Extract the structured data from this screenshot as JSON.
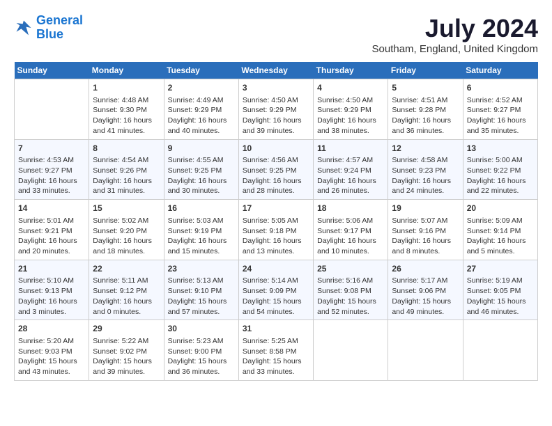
{
  "logo": {
    "line1": "General",
    "line2": "Blue"
  },
  "title": "July 2024",
  "subtitle": "Southam, England, United Kingdom",
  "columns": [
    "Sunday",
    "Monday",
    "Tuesday",
    "Wednesday",
    "Thursday",
    "Friday",
    "Saturday"
  ],
  "weeks": [
    [
      {
        "day": "",
        "info": ""
      },
      {
        "day": "1",
        "info": "Sunrise: 4:48 AM\nSunset: 9:30 PM\nDaylight: 16 hours\nand 41 minutes."
      },
      {
        "day": "2",
        "info": "Sunrise: 4:49 AM\nSunset: 9:29 PM\nDaylight: 16 hours\nand 40 minutes."
      },
      {
        "day": "3",
        "info": "Sunrise: 4:50 AM\nSunset: 9:29 PM\nDaylight: 16 hours\nand 39 minutes."
      },
      {
        "day": "4",
        "info": "Sunrise: 4:50 AM\nSunset: 9:29 PM\nDaylight: 16 hours\nand 38 minutes."
      },
      {
        "day": "5",
        "info": "Sunrise: 4:51 AM\nSunset: 9:28 PM\nDaylight: 16 hours\nand 36 minutes."
      },
      {
        "day": "6",
        "info": "Sunrise: 4:52 AM\nSunset: 9:27 PM\nDaylight: 16 hours\nand 35 minutes."
      }
    ],
    [
      {
        "day": "7",
        "info": "Sunrise: 4:53 AM\nSunset: 9:27 PM\nDaylight: 16 hours\nand 33 minutes."
      },
      {
        "day": "8",
        "info": "Sunrise: 4:54 AM\nSunset: 9:26 PM\nDaylight: 16 hours\nand 31 minutes."
      },
      {
        "day": "9",
        "info": "Sunrise: 4:55 AM\nSunset: 9:25 PM\nDaylight: 16 hours\nand 30 minutes."
      },
      {
        "day": "10",
        "info": "Sunrise: 4:56 AM\nSunset: 9:25 PM\nDaylight: 16 hours\nand 28 minutes."
      },
      {
        "day": "11",
        "info": "Sunrise: 4:57 AM\nSunset: 9:24 PM\nDaylight: 16 hours\nand 26 minutes."
      },
      {
        "day": "12",
        "info": "Sunrise: 4:58 AM\nSunset: 9:23 PM\nDaylight: 16 hours\nand 24 minutes."
      },
      {
        "day": "13",
        "info": "Sunrise: 5:00 AM\nSunset: 9:22 PM\nDaylight: 16 hours\nand 22 minutes."
      }
    ],
    [
      {
        "day": "14",
        "info": "Sunrise: 5:01 AM\nSunset: 9:21 PM\nDaylight: 16 hours\nand 20 minutes."
      },
      {
        "day": "15",
        "info": "Sunrise: 5:02 AM\nSunset: 9:20 PM\nDaylight: 16 hours\nand 18 minutes."
      },
      {
        "day": "16",
        "info": "Sunrise: 5:03 AM\nSunset: 9:19 PM\nDaylight: 16 hours\nand 15 minutes."
      },
      {
        "day": "17",
        "info": "Sunrise: 5:05 AM\nSunset: 9:18 PM\nDaylight: 16 hours\nand 13 minutes."
      },
      {
        "day": "18",
        "info": "Sunrise: 5:06 AM\nSunset: 9:17 PM\nDaylight: 16 hours\nand 10 minutes."
      },
      {
        "day": "19",
        "info": "Sunrise: 5:07 AM\nSunset: 9:16 PM\nDaylight: 16 hours\nand 8 minutes."
      },
      {
        "day": "20",
        "info": "Sunrise: 5:09 AM\nSunset: 9:14 PM\nDaylight: 16 hours\nand 5 minutes."
      }
    ],
    [
      {
        "day": "21",
        "info": "Sunrise: 5:10 AM\nSunset: 9:13 PM\nDaylight: 16 hours\nand 3 minutes."
      },
      {
        "day": "22",
        "info": "Sunrise: 5:11 AM\nSunset: 9:12 PM\nDaylight: 16 hours\nand 0 minutes."
      },
      {
        "day": "23",
        "info": "Sunrise: 5:13 AM\nSunset: 9:10 PM\nDaylight: 15 hours\nand 57 minutes."
      },
      {
        "day": "24",
        "info": "Sunrise: 5:14 AM\nSunset: 9:09 PM\nDaylight: 15 hours\nand 54 minutes."
      },
      {
        "day": "25",
        "info": "Sunrise: 5:16 AM\nSunset: 9:08 PM\nDaylight: 15 hours\nand 52 minutes."
      },
      {
        "day": "26",
        "info": "Sunrise: 5:17 AM\nSunset: 9:06 PM\nDaylight: 15 hours\nand 49 minutes."
      },
      {
        "day": "27",
        "info": "Sunrise: 5:19 AM\nSunset: 9:05 PM\nDaylight: 15 hours\nand 46 minutes."
      }
    ],
    [
      {
        "day": "28",
        "info": "Sunrise: 5:20 AM\nSunset: 9:03 PM\nDaylight: 15 hours\nand 43 minutes."
      },
      {
        "day": "29",
        "info": "Sunrise: 5:22 AM\nSunset: 9:02 PM\nDaylight: 15 hours\nand 39 minutes."
      },
      {
        "day": "30",
        "info": "Sunrise: 5:23 AM\nSunset: 9:00 PM\nDaylight: 15 hours\nand 36 minutes."
      },
      {
        "day": "31",
        "info": "Sunrise: 5:25 AM\nSunset: 8:58 PM\nDaylight: 15 hours\nand 33 minutes."
      },
      {
        "day": "",
        "info": ""
      },
      {
        "day": "",
        "info": ""
      },
      {
        "day": "",
        "info": ""
      }
    ]
  ]
}
